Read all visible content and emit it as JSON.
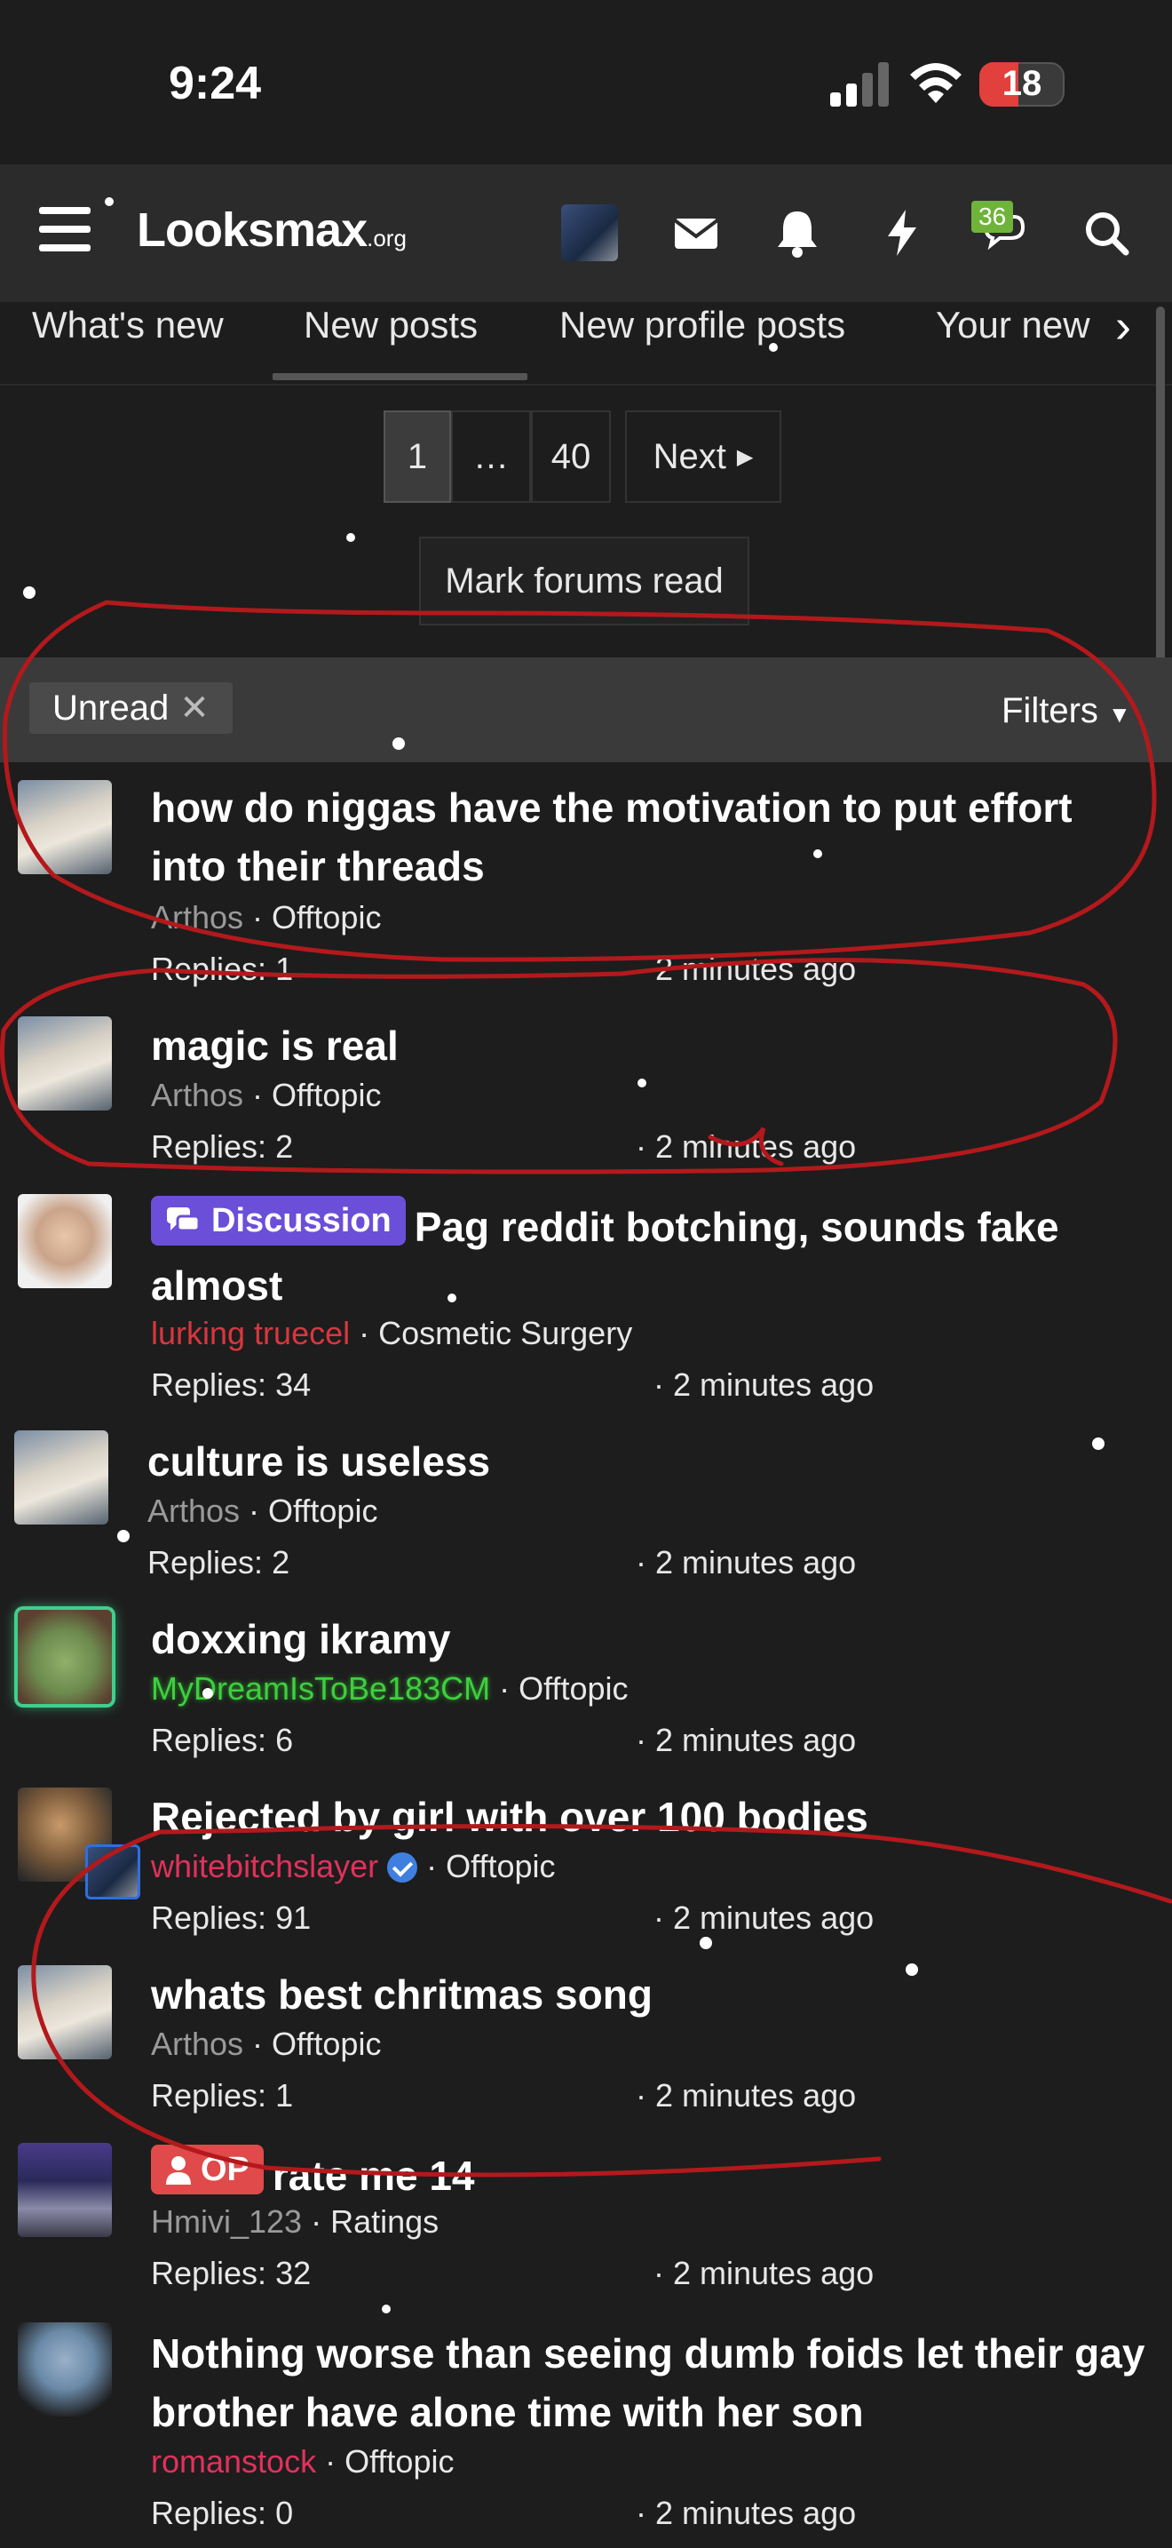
{
  "status": {
    "time": "9:24",
    "battery": "18"
  },
  "header": {
    "logo_main": "Looksmax",
    "logo_suffix": ".org",
    "messages_badge": "36"
  },
  "tabs": [
    "What's new",
    "New posts",
    "New profile posts",
    "Your new"
  ],
  "pager": {
    "page1": "1",
    "ellipsis": "…",
    "last": "40",
    "next": "Next"
  },
  "mark_read": "Mark forums read",
  "filter": {
    "chip": "Unread",
    "filters": "Filters"
  },
  "threads": [
    {
      "title": "how do niggas have the motivation to put effort into their threads",
      "author": "Arthos",
      "author_color": "#9a9a9a",
      "forum": "Offtopic",
      "replies": "Replies: 1",
      "time": "· 2 minutes ago"
    },
    {
      "title": "magic is real",
      "author": "Arthos",
      "author_color": "#9a9a9a",
      "forum": "Offtopic",
      "replies": "Replies: 2",
      "time": "· 2 minutes ago"
    },
    {
      "prefix": "Discussion",
      "title": "Pag reddit botching, sounds fake almost",
      "author": "lurking truecel",
      "author_color": "#d9363e",
      "forum": "Cosmetic Surgery",
      "replies": "Replies: 34",
      "time": "· 2 minutes ago"
    },
    {
      "title": "culture is useless",
      "author": "Arthos",
      "author_color": "#9a9a9a",
      "forum": "Offtopic",
      "replies": "Replies: 2",
      "time": "· 2 minutes ago"
    },
    {
      "title": "doxxing ikramy",
      "author": "MyDreamIsToBe183CM",
      "author_color": "#3ecf3e",
      "forum": "Offtopic",
      "replies": "Replies: 6",
      "time": "· 2 minutes ago"
    },
    {
      "title": "Rejected by girl with over 100 bodies",
      "author": "whitebitchslayer",
      "author_color": "#e0325c",
      "forum": "Offtopic",
      "replies": "Replies: 91",
      "time": "· 2 minutes ago"
    },
    {
      "title": "whats best chritmas song",
      "author": "Arthos",
      "author_color": "#9a9a9a",
      "forum": "Offtopic",
      "replies": "Replies: 1",
      "time": "· 2 minutes ago"
    },
    {
      "prefix": "OP",
      "title": "rate me 14",
      "author": "Hmivi_123",
      "author_color": "#9a9a9a",
      "forum": "Ratings",
      "replies": "Replies: 32",
      "time": "· 2 minutes ago"
    },
    {
      "title": "Nothing worse than seeing dumb foids let their gay brother have alone time with her son",
      "author": "romanstock",
      "author_color": "#e0325c",
      "forum": "Offtopic",
      "replies": "Replies: 0",
      "time": "· 2 minutes ago"
    }
  ],
  "colors": {
    "background": "#1d1d1d",
    "header": "#2b2b2b",
    "discussion_prefix": "#6b4fd8",
    "op_prefix": "#e04a4a",
    "annotation_red": "#b3191c"
  }
}
